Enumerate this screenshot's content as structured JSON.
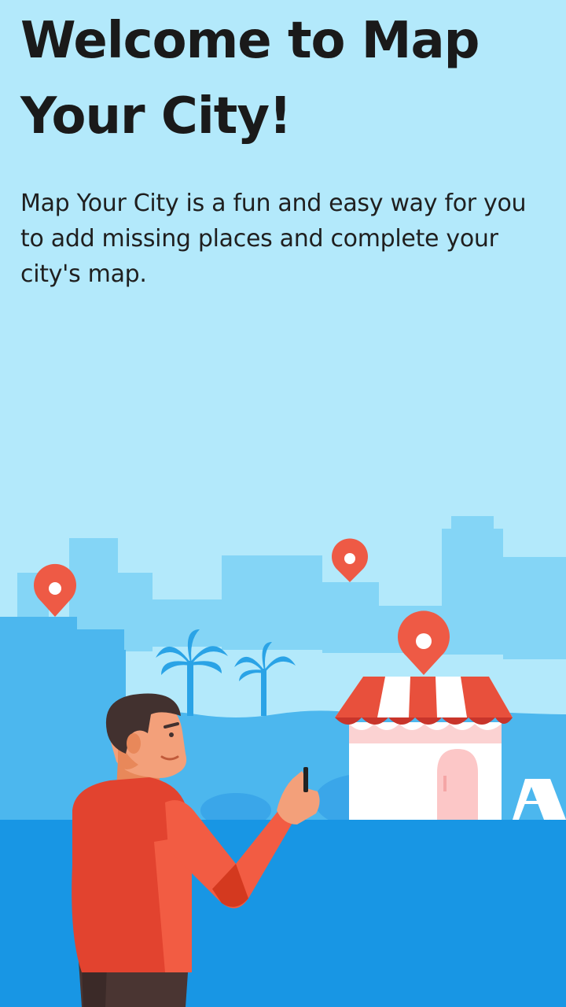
{
  "intro": {
    "title": "Welcome to Map Your City!",
    "description": "Map Your City is a fun and easy way for you to add missing places and complete your city's map."
  },
  "illustration": {
    "icons": [
      "map-pin-icon",
      "palm-tree-icon",
      "shop-icon",
      "person-icon",
      "phone-icon"
    ],
    "colors": {
      "sky": "#b3e9fb",
      "far_buildings": "#84d5f6",
      "near_buildings": "#4cb7ee",
      "ground": "#1896e4",
      "pin": "#ee5a45",
      "awning": "#e8503c",
      "shirt": "#e2432f"
    }
  }
}
